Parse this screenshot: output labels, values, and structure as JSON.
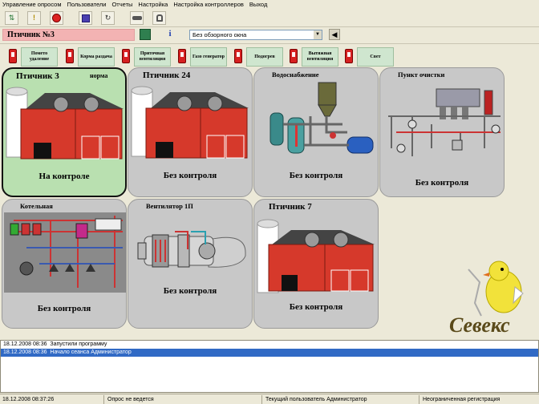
{
  "menu": [
    "Управление опросом",
    "Пользователи",
    "Отчеты",
    "Настройка",
    "Настройка контроллеров",
    "Выход"
  ],
  "toolbar": {
    "buttons": [
      {
        "name": "network-icon",
        "glyph": "⇅"
      },
      {
        "name": "exclamation-icon",
        "glyph": "!"
      },
      {
        "name": "stop-icon",
        "glyph": "⛔"
      },
      {
        "name": "chart-icon",
        "glyph": "▙"
      },
      {
        "name": "refresh-icon",
        "glyph": "↻"
      },
      {
        "name": "key-icon",
        "glyph": "⚿"
      },
      {
        "name": "lock-icon",
        "glyph": "🔒"
      }
    ]
  },
  "header": {
    "house_title": "Птичник №3",
    "view_select": "Без обзорного окна"
  },
  "controls": [
    {
      "label": "Пометоудаление",
      "html_label": "Помето удаление"
    },
    {
      "label": "Кормораздача",
      "html_label": "Корма раздача"
    },
    {
      "label": "Приточная вентиляция",
      "html_label": "Приточная вентиляция"
    },
    {
      "label": "Газо генератор",
      "html_label": "Газо генератор"
    },
    {
      "label": "Подогрев",
      "html_label": "Подогрев"
    },
    {
      "label": "Вытяжная вентиляция",
      "html_label": "Вытяжная вентиляция"
    },
    {
      "label": "Свет",
      "html_label": "Свет"
    }
  ],
  "tiles": [
    {
      "name": "Птичник 3",
      "norm": "норма",
      "status": "На контроле",
      "kind": "barn",
      "active": true
    },
    {
      "name": "Птичник 24",
      "status": "Без контроля",
      "kind": "barn"
    },
    {
      "name": "Водоснабжение",
      "status": "Без контроля",
      "kind": "water"
    },
    {
      "name": "Пункт очистки",
      "status": "Без контроля",
      "kind": "clean"
    },
    {
      "name": "Котельная",
      "status": "Без контроля",
      "kind": "boiler"
    },
    {
      "name": "Вентилятор 1П",
      "status": "Без контроля",
      "kind": "fan"
    },
    {
      "name": "Птичник 7",
      "status": "Без контроля",
      "kind": "barn"
    }
  ],
  "logo_text": "Севекс",
  "log": [
    {
      "time": "18.12.2008 08:36",
      "text": "Запустили программу"
    },
    {
      "time": "18.12.2008 08:36",
      "text": "Начало сеанса Администратор"
    }
  ],
  "status": {
    "datetime": "18.12.2008   08:37:26",
    "poll": "Опрос не ведется",
    "user": "Текущий пользователь  Администратор",
    "registration": "Неограниченная регистрация"
  }
}
